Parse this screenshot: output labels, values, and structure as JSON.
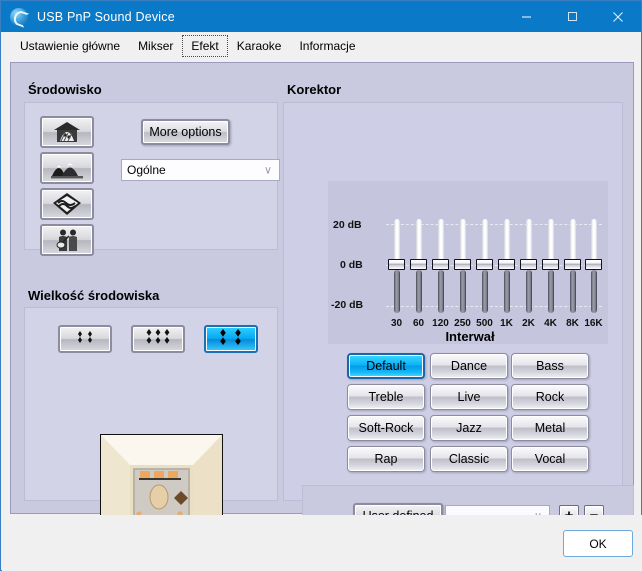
{
  "window": {
    "title": "USB PnP Sound Device",
    "icon": "sound-device-icon",
    "minimize_label": "─",
    "maximize_label": "□",
    "close_label": "✕",
    "accent_titlebar": "#0a7ac8",
    "page_background": "#c9c9e0"
  },
  "tabs": [
    {
      "label": "Ustawienie główne",
      "selected": false
    },
    {
      "label": "Mikser",
      "selected": false
    },
    {
      "label": "Efekt",
      "selected": true
    },
    {
      "label": "Karaoke",
      "selected": false
    },
    {
      "label": "Informacje",
      "selected": false
    }
  ],
  "environment": {
    "legend": "Środowisko",
    "icon_buttons": [
      {
        "name": "cave-icon",
        "selected": false
      },
      {
        "name": "mountains-icon",
        "selected": false
      },
      {
        "name": "carpet-icon",
        "selected": false
      },
      {
        "name": "people-icon",
        "selected": false
      }
    ],
    "more_options_label": "More options",
    "preset_value": "Ogólne",
    "preset_chevron": "∨"
  },
  "environment_size": {
    "legend": "Wielkość środowiska",
    "buttons": [
      {
        "name": "size-small",
        "selected": false
      },
      {
        "name": "size-medium",
        "selected": false
      },
      {
        "name": "size-large",
        "selected": true
      }
    ],
    "preview_alt": "room-preview"
  },
  "equalizer": {
    "legend": "Korektor",
    "axis_label": "Interwał",
    "db_ticks": [
      "20 dB",
      "0  dB",
      "-20 dB"
    ],
    "presets": [
      {
        "label": "Default",
        "selected": true
      },
      {
        "label": "Dance",
        "selected": false
      },
      {
        "label": "Bass",
        "selected": false
      },
      {
        "label": "Treble",
        "selected": false
      },
      {
        "label": "Live",
        "selected": false
      },
      {
        "label": "Rock",
        "selected": false
      },
      {
        "label": "Soft-Rock",
        "selected": false
      },
      {
        "label": "Jazz",
        "selected": false
      },
      {
        "label": "Metal",
        "selected": false
      },
      {
        "label": "Rap",
        "selected": false
      },
      {
        "label": "Classic",
        "selected": false
      },
      {
        "label": "Vocal",
        "selected": false
      }
    ],
    "user_defined_label": "User defined",
    "user_combo_value": "",
    "user_name_value": "",
    "add_label": "+",
    "remove_label": "−",
    "combo_chevron": "∨"
  },
  "footer": {
    "ok_label": "OK"
  },
  "chart_data": {
    "type": "bar",
    "title": "Korektor",
    "xlabel": "Interwał",
    "ylabel": "dB",
    "ylim": [
      -20,
      20
    ],
    "grid": true,
    "categories": [
      "30",
      "60",
      "120",
      "250",
      "500",
      "1K",
      "2K",
      "4K",
      "8K",
      "16K"
    ],
    "values": [
      0,
      0,
      0,
      0,
      0,
      0,
      0,
      0,
      0,
      0
    ],
    "tick_labels_y": [
      "20 dB",
      "0  dB",
      "-20 dB"
    ]
  }
}
